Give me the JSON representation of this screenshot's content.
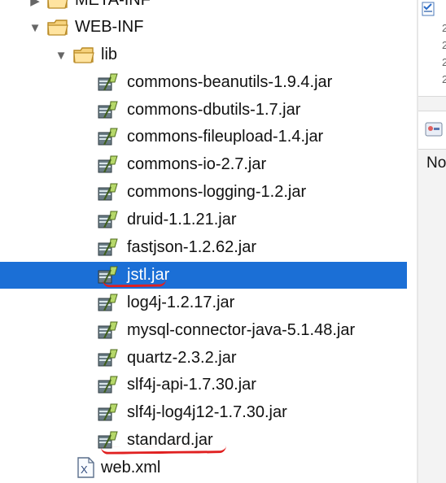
{
  "tree": {
    "items": [
      {
        "label": "META-INF",
        "type": "folder",
        "expanded": false
      },
      {
        "label": "WEB-INF",
        "type": "folder",
        "expanded": true
      },
      {
        "label": "lib",
        "type": "folder",
        "expanded": true
      },
      {
        "label": "commons-beanutils-1.9.4.jar",
        "type": "jar"
      },
      {
        "label": "commons-dbutils-1.7.jar",
        "type": "jar"
      },
      {
        "label": "commons-fileupload-1.4.jar",
        "type": "jar"
      },
      {
        "label": "commons-io-2.7.jar",
        "type": "jar"
      },
      {
        "label": "commons-logging-1.2.jar",
        "type": "jar"
      },
      {
        "label": "druid-1.1.21.jar",
        "type": "jar"
      },
      {
        "label": "fastjson-1.2.62.jar",
        "type": "jar"
      },
      {
        "label": "jstl.jar",
        "type": "jar",
        "selected": true
      },
      {
        "label": "log4j-1.2.17.jar",
        "type": "jar"
      },
      {
        "label": "mysql-connector-java-5.1.48.jar",
        "type": "jar"
      },
      {
        "label": "quartz-2.3.2.jar",
        "type": "jar"
      },
      {
        "label": "slf4j-api-1.7.30.jar",
        "type": "jar"
      },
      {
        "label": "slf4j-log4j12-1.7.30.jar",
        "type": "jar"
      },
      {
        "label": "standard.jar",
        "type": "jar"
      },
      {
        "label": "web.xml",
        "type": "xml"
      }
    ]
  },
  "side_panel": {
    "text": "No"
  },
  "icons": {
    "folder": "folder-icon",
    "jar": "jar-icon",
    "xml": "xml-file-icon",
    "expanded": "triangle-down-icon",
    "collapsed": "triangle-right-icon"
  },
  "colors": {
    "selection": "#1b6fd6",
    "annotation": "#e02020"
  }
}
